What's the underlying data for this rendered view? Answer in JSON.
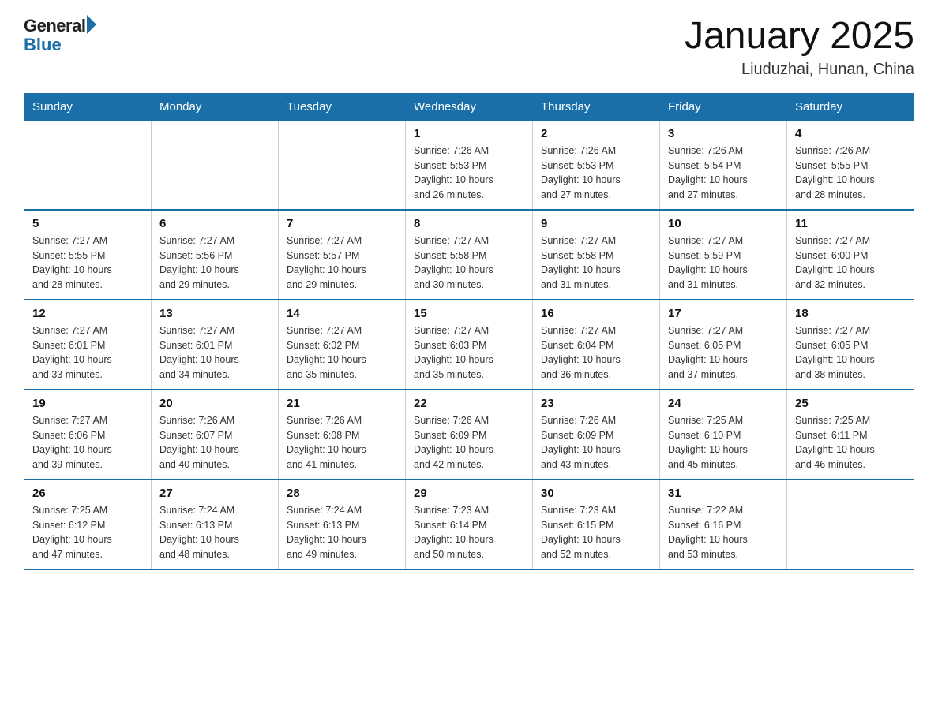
{
  "header": {
    "logo_general": "General",
    "logo_blue": "Blue",
    "title": "January 2025",
    "subtitle": "Liuduzhai, Hunan, China"
  },
  "days_of_week": [
    "Sunday",
    "Monday",
    "Tuesday",
    "Wednesday",
    "Thursday",
    "Friday",
    "Saturday"
  ],
  "weeks": [
    [
      {
        "day": "",
        "info": ""
      },
      {
        "day": "",
        "info": ""
      },
      {
        "day": "",
        "info": ""
      },
      {
        "day": "1",
        "info": "Sunrise: 7:26 AM\nSunset: 5:53 PM\nDaylight: 10 hours\nand 26 minutes."
      },
      {
        "day": "2",
        "info": "Sunrise: 7:26 AM\nSunset: 5:53 PM\nDaylight: 10 hours\nand 27 minutes."
      },
      {
        "day": "3",
        "info": "Sunrise: 7:26 AM\nSunset: 5:54 PM\nDaylight: 10 hours\nand 27 minutes."
      },
      {
        "day": "4",
        "info": "Sunrise: 7:26 AM\nSunset: 5:55 PM\nDaylight: 10 hours\nand 28 minutes."
      }
    ],
    [
      {
        "day": "5",
        "info": "Sunrise: 7:27 AM\nSunset: 5:55 PM\nDaylight: 10 hours\nand 28 minutes."
      },
      {
        "day": "6",
        "info": "Sunrise: 7:27 AM\nSunset: 5:56 PM\nDaylight: 10 hours\nand 29 minutes."
      },
      {
        "day": "7",
        "info": "Sunrise: 7:27 AM\nSunset: 5:57 PM\nDaylight: 10 hours\nand 29 minutes."
      },
      {
        "day": "8",
        "info": "Sunrise: 7:27 AM\nSunset: 5:58 PM\nDaylight: 10 hours\nand 30 minutes."
      },
      {
        "day": "9",
        "info": "Sunrise: 7:27 AM\nSunset: 5:58 PM\nDaylight: 10 hours\nand 31 minutes."
      },
      {
        "day": "10",
        "info": "Sunrise: 7:27 AM\nSunset: 5:59 PM\nDaylight: 10 hours\nand 31 minutes."
      },
      {
        "day": "11",
        "info": "Sunrise: 7:27 AM\nSunset: 6:00 PM\nDaylight: 10 hours\nand 32 minutes."
      }
    ],
    [
      {
        "day": "12",
        "info": "Sunrise: 7:27 AM\nSunset: 6:01 PM\nDaylight: 10 hours\nand 33 minutes."
      },
      {
        "day": "13",
        "info": "Sunrise: 7:27 AM\nSunset: 6:01 PM\nDaylight: 10 hours\nand 34 minutes."
      },
      {
        "day": "14",
        "info": "Sunrise: 7:27 AM\nSunset: 6:02 PM\nDaylight: 10 hours\nand 35 minutes."
      },
      {
        "day": "15",
        "info": "Sunrise: 7:27 AM\nSunset: 6:03 PM\nDaylight: 10 hours\nand 35 minutes."
      },
      {
        "day": "16",
        "info": "Sunrise: 7:27 AM\nSunset: 6:04 PM\nDaylight: 10 hours\nand 36 minutes."
      },
      {
        "day": "17",
        "info": "Sunrise: 7:27 AM\nSunset: 6:05 PM\nDaylight: 10 hours\nand 37 minutes."
      },
      {
        "day": "18",
        "info": "Sunrise: 7:27 AM\nSunset: 6:05 PM\nDaylight: 10 hours\nand 38 minutes."
      }
    ],
    [
      {
        "day": "19",
        "info": "Sunrise: 7:27 AM\nSunset: 6:06 PM\nDaylight: 10 hours\nand 39 minutes."
      },
      {
        "day": "20",
        "info": "Sunrise: 7:26 AM\nSunset: 6:07 PM\nDaylight: 10 hours\nand 40 minutes."
      },
      {
        "day": "21",
        "info": "Sunrise: 7:26 AM\nSunset: 6:08 PM\nDaylight: 10 hours\nand 41 minutes."
      },
      {
        "day": "22",
        "info": "Sunrise: 7:26 AM\nSunset: 6:09 PM\nDaylight: 10 hours\nand 42 minutes."
      },
      {
        "day": "23",
        "info": "Sunrise: 7:26 AM\nSunset: 6:09 PM\nDaylight: 10 hours\nand 43 minutes."
      },
      {
        "day": "24",
        "info": "Sunrise: 7:25 AM\nSunset: 6:10 PM\nDaylight: 10 hours\nand 45 minutes."
      },
      {
        "day": "25",
        "info": "Sunrise: 7:25 AM\nSunset: 6:11 PM\nDaylight: 10 hours\nand 46 minutes."
      }
    ],
    [
      {
        "day": "26",
        "info": "Sunrise: 7:25 AM\nSunset: 6:12 PM\nDaylight: 10 hours\nand 47 minutes."
      },
      {
        "day": "27",
        "info": "Sunrise: 7:24 AM\nSunset: 6:13 PM\nDaylight: 10 hours\nand 48 minutes."
      },
      {
        "day": "28",
        "info": "Sunrise: 7:24 AM\nSunset: 6:13 PM\nDaylight: 10 hours\nand 49 minutes."
      },
      {
        "day": "29",
        "info": "Sunrise: 7:23 AM\nSunset: 6:14 PM\nDaylight: 10 hours\nand 50 minutes."
      },
      {
        "day": "30",
        "info": "Sunrise: 7:23 AM\nSunset: 6:15 PM\nDaylight: 10 hours\nand 52 minutes."
      },
      {
        "day": "31",
        "info": "Sunrise: 7:22 AM\nSunset: 6:16 PM\nDaylight: 10 hours\nand 53 minutes."
      },
      {
        "day": "",
        "info": ""
      }
    ]
  ]
}
